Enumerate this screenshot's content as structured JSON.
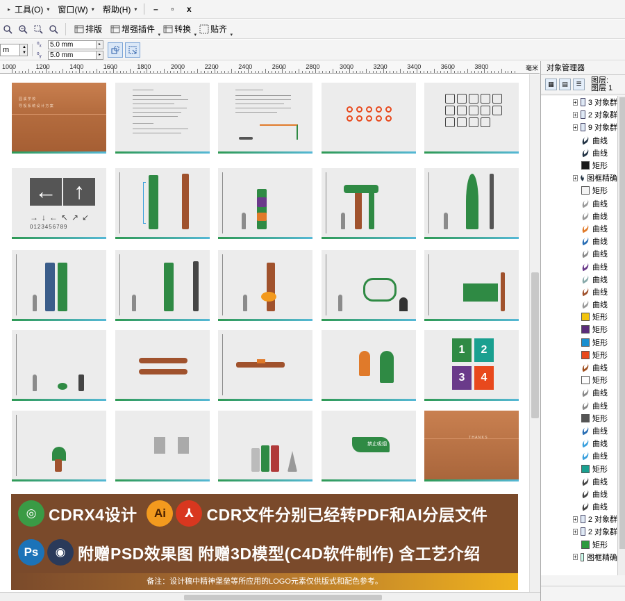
{
  "menubar": {
    "items": [
      "工具(O)",
      "窗口(W)",
      "帮助(H)"
    ],
    "window_controls": [
      "–",
      "▫",
      "x"
    ]
  },
  "toolbar": {
    "buttons": [
      "排版",
      "增强插件",
      "转换",
      "贴齐"
    ]
  },
  "propbar": {
    "unit_suffix": "m",
    "offset_x": "5.0 mm",
    "offset_y": "5.0 mm"
  },
  "ruler": {
    "labels": [
      "1000",
      "1200",
      "1400",
      "1600",
      "1800",
      "2000",
      "2200",
      "2400",
      "2600",
      "2800",
      "3000",
      "3200",
      "3400",
      "3600",
      "3800"
    ],
    "unit": "毫米"
  },
  "pages": {
    "p1": {
      "line1": "园 溪 学 校",
      "line2": "导 视 系 统 设 计 方 案"
    },
    "p5_digits": "0123456789",
    "p_thanks": "T H A N K S",
    "wayfind": [
      "1",
      "2",
      "3",
      "4"
    ],
    "sign_green": "禁止吸烟"
  },
  "banner": {
    "logos": [
      "Ai",
      "Ps"
    ],
    "line1_a": "CDRX4设计",
    "line1_b": "CDR文件分别已经转PDF和AI分层文件",
    "line2": "附赠PSD效果图 附赠3D模型(C4D软件制作) 含工艺介绍",
    "note": "备注：设计稿中精神堡垒等所应用的LOGO元素仅供版式和配色参考。"
  },
  "panel": {
    "title": "对象管理器",
    "layer_a": "图层:",
    "layer_b": "图层 1",
    "tree": [
      {
        "exp": "+",
        "icon": "group",
        "label": "3 对象群"
      },
      {
        "exp": "+",
        "icon": "group",
        "label": "2 对象群"
      },
      {
        "exp": "+",
        "icon": "group",
        "label": "9 对象群"
      },
      {
        "exp": "",
        "icon": "curve",
        "color": "#234",
        "label": "曲线"
      },
      {
        "exp": "",
        "icon": "curve",
        "color": "#234",
        "label": "曲线"
      },
      {
        "exp": "",
        "icon": "rect",
        "color": "#1a1a1a",
        "label": "矩形"
      },
      {
        "exp": "+",
        "icon": "curve",
        "color": "#234",
        "label": "图框精确"
      },
      {
        "exp": "",
        "icon": "rect",
        "color": "#f4f4f4",
        "label": "矩形"
      },
      {
        "exp": "",
        "icon": "curve",
        "color": "#999",
        "label": "曲线"
      },
      {
        "exp": "",
        "icon": "curve",
        "color": "#999",
        "label": "曲线"
      },
      {
        "exp": "",
        "icon": "curve",
        "color": "#e07a2a",
        "label": "曲线"
      },
      {
        "exp": "",
        "icon": "curve",
        "color": "#2a6fb5",
        "label": "曲线"
      },
      {
        "exp": "",
        "icon": "curve",
        "color": "#888",
        "label": "曲线"
      },
      {
        "exp": "",
        "icon": "curve",
        "color": "#6a3a8a",
        "label": "曲线"
      },
      {
        "exp": "",
        "icon": "curve",
        "color": "#8aa",
        "label": "曲线"
      },
      {
        "exp": "",
        "icon": "curve",
        "color": "#a0522d",
        "label": "曲线"
      },
      {
        "exp": "",
        "icon": "curve",
        "color": "#999",
        "label": "曲线"
      },
      {
        "exp": "",
        "icon": "rect",
        "color": "#f1c40f",
        "label": "矩形"
      },
      {
        "exp": "",
        "icon": "rect",
        "color": "#5b2d7a",
        "label": "矩形"
      },
      {
        "exp": "",
        "icon": "rect",
        "color": "#1a8fd0",
        "label": "矩形"
      },
      {
        "exp": "",
        "icon": "rect",
        "color": "#e8491d",
        "label": "矩形"
      },
      {
        "exp": "",
        "icon": "curve",
        "color": "#a05020",
        "label": "曲线"
      },
      {
        "exp": "",
        "icon": "rect",
        "color": "#fdfdfd",
        "label": "矩形"
      },
      {
        "exp": "",
        "icon": "curve",
        "color": "#888",
        "label": "曲线"
      },
      {
        "exp": "",
        "icon": "curve",
        "color": "#888",
        "label": "曲线"
      },
      {
        "exp": "",
        "icon": "rect",
        "color": "#555",
        "label": "矩形"
      },
      {
        "exp": "",
        "icon": "curve",
        "color": "#2a6fb5",
        "label": "曲线"
      },
      {
        "exp": "",
        "icon": "curve",
        "color": "#3aa0dd",
        "label": "曲线"
      },
      {
        "exp": "",
        "icon": "curve",
        "color": "#3aa0dd",
        "label": "曲线"
      },
      {
        "exp": "",
        "icon": "rect",
        "color": "#1aa090",
        "label": "矩形"
      },
      {
        "exp": "",
        "icon": "curve",
        "color": "#444",
        "label": "曲线"
      },
      {
        "exp": "",
        "icon": "curve",
        "color": "#444",
        "label": "曲线"
      },
      {
        "exp": "",
        "icon": "curve",
        "color": "#444",
        "label": "曲线"
      },
      {
        "exp": "+",
        "icon": "group",
        "label": "2 对象群"
      },
      {
        "exp": "+",
        "icon": "group",
        "label": "2 对象群"
      },
      {
        "exp": "",
        "icon": "rect",
        "color": "#2e9a3e",
        "label": "矩形"
      },
      {
        "exp": "+",
        "icon": "rect",
        "color": "#cfe",
        "label": "图框精确"
      }
    ]
  },
  "colors": {
    "brown": "#7a4a2b",
    "green": "#2f8a44",
    "orange": "#e07a2a",
    "ai": "#f39a1e",
    "pdf": "#d8371f",
    "ps": "#1c73b8"
  }
}
